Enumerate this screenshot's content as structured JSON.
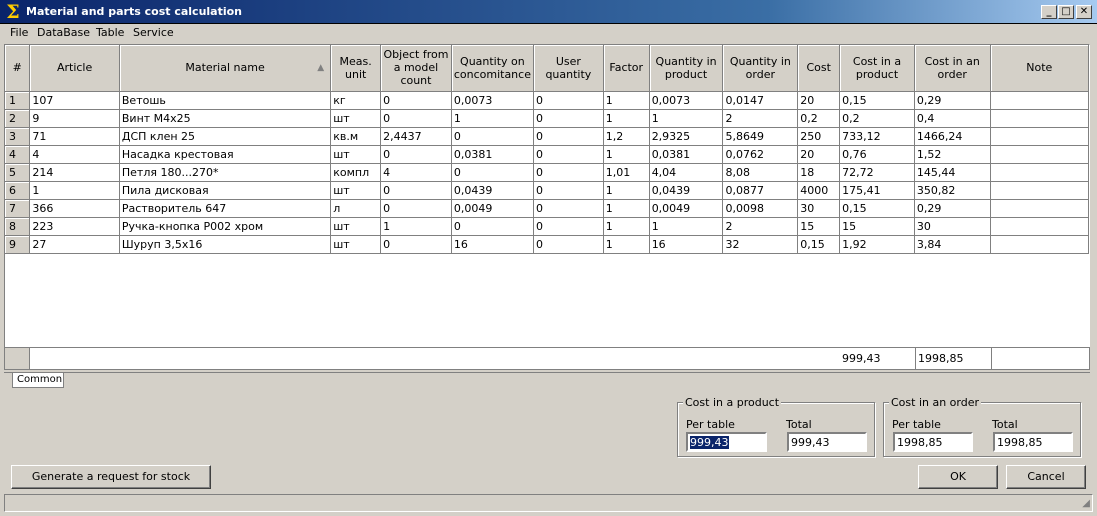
{
  "window": {
    "title": "Material and parts cost calculation"
  },
  "menu": [
    "File",
    "DataBase",
    "Table",
    "Service"
  ],
  "table": {
    "columns": [
      "#",
      "Article",
      "Material name",
      "Meas. unit",
      "Object from a model count",
      "Quantity on concomitance",
      "User quantity",
      "Factor",
      "Quantity in product",
      "Quantity in order",
      "Cost",
      "Cost in a product",
      "Cost in an order",
      "Note"
    ],
    "rows": [
      [
        "1",
        "107",
        "Ветошь",
        "кг",
        "0",
        "0,0073",
        "0",
        "1",
        "0,0073",
        "0,0147",
        "20",
        "0,15",
        "0,29",
        ""
      ],
      [
        "2",
        "9",
        "Винт М4х25",
        "шт",
        "0",
        "1",
        "0",
        "1",
        "1",
        "2",
        "0,2",
        "0,2",
        "0,4",
        ""
      ],
      [
        "3",
        "71",
        "ДСП клен 25",
        "кв.м",
        "2,4437",
        "0",
        "0",
        "1,2",
        "2,9325",
        "5,8649",
        "250",
        "733,12",
        "1466,24",
        ""
      ],
      [
        "4",
        "4",
        "Насадка крестовая",
        "шт",
        "0",
        "0,0381",
        "0",
        "1",
        "0,0381",
        "0,0762",
        "20",
        "0,76",
        "1,52",
        ""
      ],
      [
        "5",
        "214",
        "Петля 180...270*",
        "компл",
        "4",
        "0",
        "0",
        "1,01",
        "4,04",
        "8,08",
        "18",
        "72,72",
        "145,44",
        ""
      ],
      [
        "6",
        "1",
        "Пила дисковая",
        "шт",
        "0",
        "0,0439",
        "0",
        "1",
        "0,0439",
        "0,0877",
        "4000",
        "175,41",
        "350,82",
        ""
      ],
      [
        "7",
        "366",
        "Растворитель 647",
        "л",
        "0",
        "0,0049",
        "0",
        "1",
        "0,0049",
        "0,0098",
        "30",
        "0,15",
        "0,29",
        ""
      ],
      [
        "8",
        "223",
        "Ручка-кнопка Р002 хром",
        "шт",
        "1",
        "0",
        "0",
        "1",
        "1",
        "2",
        "15",
        "15",
        "30",
        ""
      ],
      [
        "9",
        "27",
        "Шуруп 3,5х16",
        "шт",
        "0",
        "16",
        "0",
        "1",
        "16",
        "32",
        "0,15",
        "1,92",
        "3,84",
        ""
      ]
    ],
    "totals": {
      "cost_in_product": "999,43",
      "cost_in_order": "1998,85"
    }
  },
  "tab": {
    "label": "Common"
  },
  "cost_product": {
    "title": "Cost in a product",
    "per_table_label": "Per table",
    "per_table_value": "999,43",
    "total_label": "Total",
    "total_value": "999,43"
  },
  "cost_order": {
    "title": "Cost in an order",
    "per_table_label": "Per table",
    "per_table_value": "1998,85",
    "total_label": "Total",
    "total_value": "1998,85"
  },
  "buttons": {
    "generate": "Generate a request for stock",
    "ok": "OK",
    "cancel": "Cancel"
  }
}
